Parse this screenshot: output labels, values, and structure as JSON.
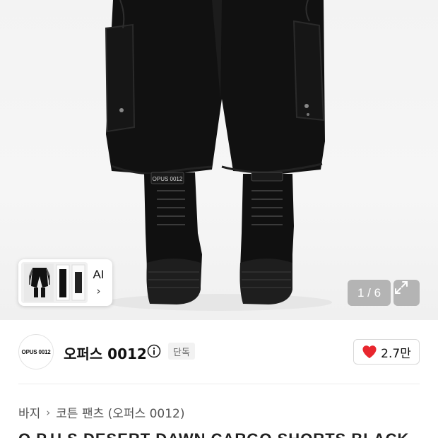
{
  "gallery": {
    "counter": "1 / 6",
    "ai_card": {
      "label": "AI",
      "chevron": "›"
    },
    "product_logo_patch": "OPUS 0012"
  },
  "brand": {
    "logo_text": "OPUS 0012",
    "name": "오퍼스 0012",
    "badge": "단독",
    "likes": "2.7만"
  },
  "breadcrumb": {
    "items": [
      "바지",
      "코튼 팬츠 (오퍼스 0012)"
    ],
    "separator": "›"
  },
  "product": {
    "title_partial": "O.P.U.S DESERT DAWN CARGO SHORTS BLACK"
  },
  "colors": {
    "like_heart": "#e8262e",
    "background": "#ffffff",
    "badge_bg": "#f2f2f2"
  }
}
